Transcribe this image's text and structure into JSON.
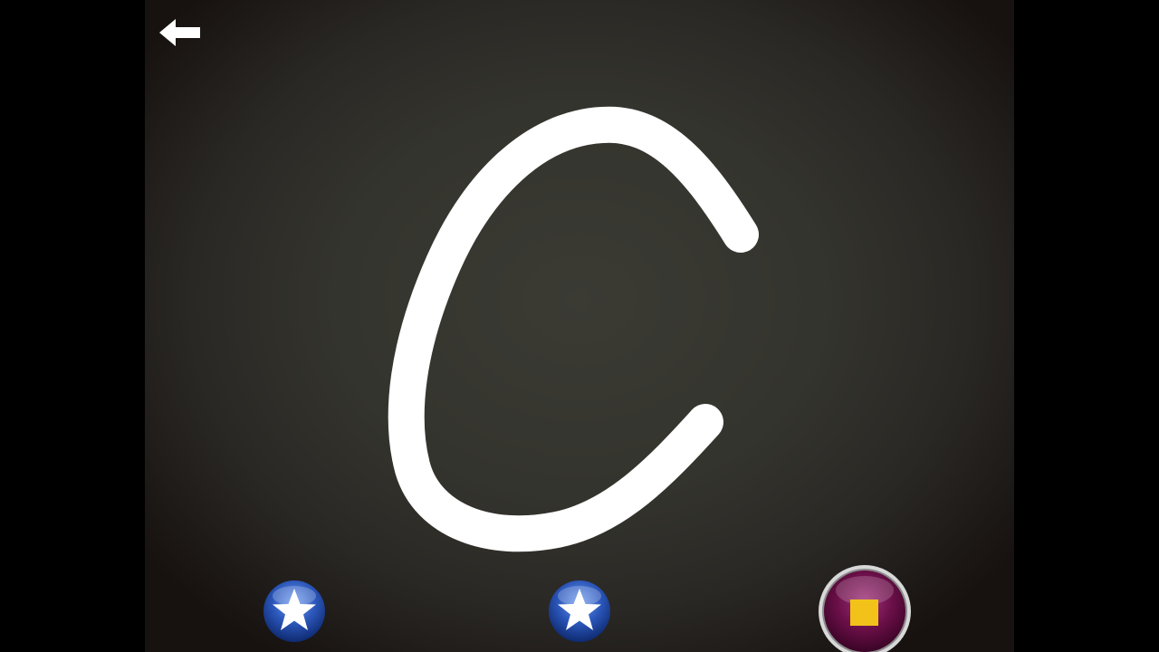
{
  "app": {
    "background_color": "#34342e",
    "frame_color": "#000000"
  },
  "toolbar": {
    "back_icon": "left-arrow",
    "back_icon_color": "#ffffff"
  },
  "tracing": {
    "letter": "c",
    "stroke_color": "#ffffff"
  },
  "bottom_bar": {
    "star_buttons": [
      {
        "icon": "star",
        "color": "#1f48a8"
      },
      {
        "icon": "star",
        "color": "#1f48a8"
      }
    ],
    "stop_button": {
      "icon": "stop-square",
      "color": "#5a0a3c",
      "icon_color": "#f2c21b"
    }
  }
}
